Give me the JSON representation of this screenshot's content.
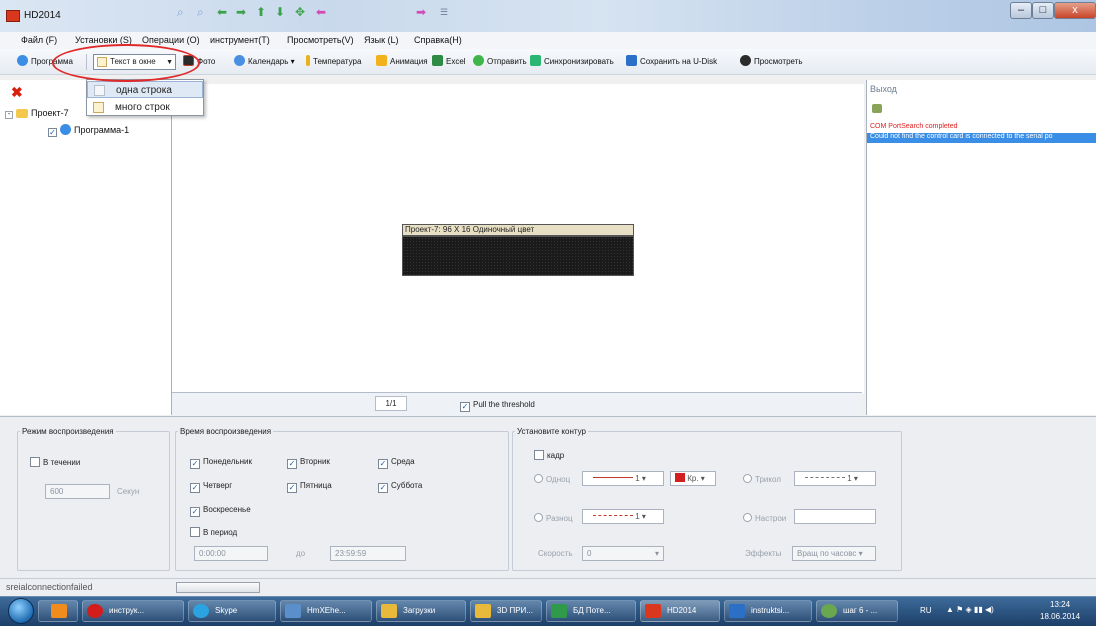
{
  "window": {
    "title": "HD2014",
    "controls": [
      "–",
      "□",
      "x"
    ]
  },
  "menu": [
    "Файл (F)",
    "Установки (S)",
    "Операции (O)",
    "инструмент(T)",
    "Просмотреть(V)",
    "Язык (L)",
    "Справка(H)"
  ],
  "toolbar": {
    "program": "Программа",
    "text_combo": "Текст в окне",
    "photo": "Фото",
    "calendar": "Календарь",
    "temperature": "Температура",
    "animation": "Анимация",
    "excel": "Excel",
    "send": "Отправить",
    "sync": "Синхронизировать",
    "save_udisk": "Сохранить на U-Disk",
    "preview": "Просмотреть"
  },
  "dropdown": {
    "items": [
      "одна строка",
      "много строк"
    ]
  },
  "tree": {
    "project": "Проект-7",
    "program": "Программа-1"
  },
  "preview": {
    "title": "Проект-7: 96 X 16 Одиночный цвет"
  },
  "nav": {
    "page": "1/1",
    "threshold": "Pull the threshold"
  },
  "output": {
    "title": "Выход",
    "lines": [
      "COM PortSearch completed",
      "Could not find the control card is connected to the serial po"
    ]
  },
  "playback_mode": {
    "title": "Режим воспроизведения",
    "during": "В течении",
    "seconds_value": "600",
    "seconds_unit": "Секун"
  },
  "playback_time": {
    "title": "Время воспроизведения",
    "days": [
      "Понедельник",
      "Вторник",
      "Среда",
      "Четверг",
      "Пятница",
      "Суббота",
      "Воскресенье"
    ],
    "period": "В период",
    "from": "0:00:00",
    "to_label": "до",
    "to": "23:59:59"
  },
  "contour": {
    "title": "Установите контур",
    "frame": "кадр",
    "single": "Одноц",
    "single_value": "1",
    "color": "Кр.",
    "tricolor": "Трикол",
    "tricolor_value": "1",
    "multi": "Разноц",
    "multi_value": "1",
    "custom": "Настрои",
    "speed": "Скорость",
    "speed_value": "0",
    "effects": "Эффекты",
    "effects_value": "Вращ по часовс"
  },
  "status": {
    "text": "sreialconnectionfailed"
  },
  "taskbar": {
    "tasks": [
      "инструк...",
      "Skype",
      "HmXEhe...",
      "Загрузки",
      "3D ПРИ...",
      "БД Поте...",
      "HD2014",
      "instruktsi...",
      "шаг 6 - ..."
    ],
    "lang": "RU",
    "time": "13:24",
    "date": "18.06.2014"
  },
  "colors": {
    "accent": "#3a8ee6",
    "error": "#d22222",
    "highlight": "#e02a2a"
  }
}
